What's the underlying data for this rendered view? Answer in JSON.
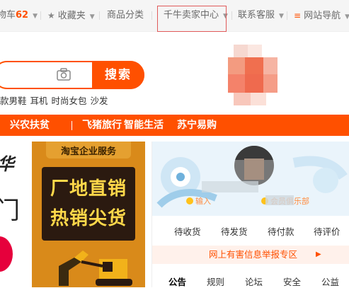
{
  "topbar": {
    "cart_label": "物车",
    "cart_count": "62",
    "favorites_label": "收藏夹",
    "categories_label": "商品分类",
    "seller_center_label": "千牛卖家中心",
    "support_label": "联系客服",
    "site_nav_label": "网站导航"
  },
  "search": {
    "button_label": "搜索",
    "hot_words": [
      "款男鞋",
      "耳机",
      "时尚女包",
      "沙发"
    ]
  },
  "nav": {
    "items": [
      "兴农扶贫",
      "飞猪旅行",
      "智能生活",
      "苏宁易购"
    ]
  },
  "banner": {
    "brand": "淘宝企业服务",
    "line1": "厂地直销",
    "line2": "热销尖货"
  },
  "left_brand": {
    "char1": "华",
    "char2": "门"
  },
  "user_panel": {
    "tag_left": "输入",
    "tag_right": "会员俱乐部",
    "status": [
      "待收货",
      "待发货",
      "待付款",
      "待评价"
    ],
    "report_label": "网上有害信息举报专区",
    "report_arrow": "▶",
    "tabs": [
      "公告",
      "规则",
      "论坛",
      "安全",
      "公益"
    ]
  },
  "colors": {
    "accent": "#ff5000",
    "highlight": "#e05a5a",
    "banner_bg": "#d98a1a"
  }
}
